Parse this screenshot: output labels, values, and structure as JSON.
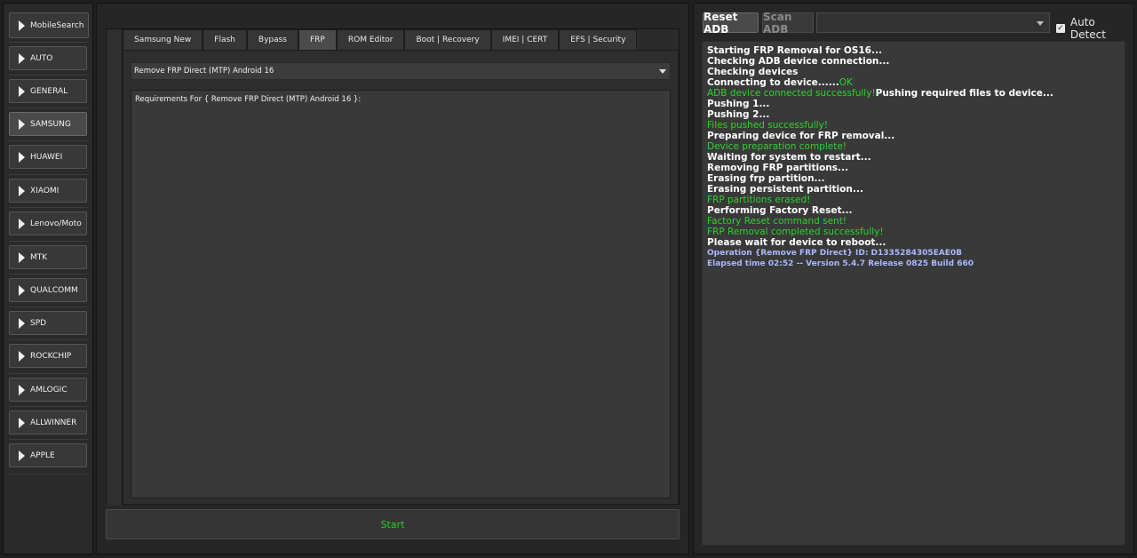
{
  "sidebar": {
    "items": [
      {
        "label": "MobileSearch"
      },
      {
        "label": "AUTO"
      },
      {
        "label": "GENERAL"
      },
      {
        "label": "SAMSUNG"
      },
      {
        "label": "HUAWEI"
      },
      {
        "label": "XIAOMI"
      },
      {
        "label": "Lenovo/Moto"
      },
      {
        "label": "MTK"
      },
      {
        "label": "QUALCOMM"
      },
      {
        "label": "SPD"
      },
      {
        "label": "ROCKCHIP"
      },
      {
        "label": "AMLOGIC"
      },
      {
        "label": "ALLWINNER"
      },
      {
        "label": "APPLE"
      }
    ],
    "active": "SAMSUNG"
  },
  "tabs": [
    {
      "label": "Samsung New"
    },
    {
      "label": "Flash"
    },
    {
      "label": "Bypass"
    },
    {
      "label": "FRP"
    },
    {
      "label": "ROM Editor"
    },
    {
      "label": "Boot | Recovery"
    },
    {
      "label": "IMEI | CERT"
    },
    {
      "label": "EFS | Security"
    }
  ],
  "active_tab": "FRP",
  "operation_select": {
    "value": "Remove FRP Direct (MTP) Android 16"
  },
  "requirements": {
    "text": "Requirements For { Remove FRP Direct (MTP) Android 16 }:"
  },
  "start_button": {
    "label": "Start"
  },
  "toolbar": {
    "reset_adb": "Reset ADB",
    "scan_adb": "Scan ADB",
    "port_select_value": "",
    "auto_detect_label": "Auto Detect",
    "auto_detect_checked": true
  },
  "log": [
    [
      {
        "t": "Starting FRP Removal for OS16...",
        "c": "w"
      }
    ],
    [
      {
        "t": "Checking ADB device connection...",
        "c": "w"
      }
    ],
    [
      {
        "t": "Checking devices",
        "c": "w"
      }
    ],
    [
      {
        "t": "Connecting to device......",
        "c": "w"
      },
      {
        "t": "OK",
        "c": "g"
      }
    ],
    [
      {
        "t": "ADB device connected successfully!",
        "c": "g"
      },
      {
        "t": "Pushing required files to device...",
        "c": "w"
      }
    ],
    [
      {
        "t": "Pushing 1...",
        "c": "w"
      }
    ],
    [
      {
        "t": "Pushing 2...",
        "c": "w"
      }
    ],
    [
      {
        "t": "Files pushed successfully!",
        "c": "g"
      }
    ],
    [
      {
        "t": "Preparing device for FRP removal...",
        "c": "w"
      }
    ],
    [
      {
        "t": "Device preparation complete!",
        "c": "g"
      }
    ],
    [
      {
        "t": "Waiting for system to restart...",
        "c": "w"
      }
    ],
    [
      {
        "t": "Removing FRP partitions...",
        "c": "w"
      }
    ],
    [
      {
        "t": "Erasing frp partition...",
        "c": "w"
      }
    ],
    [
      {
        "t": "Erasing persistent partition...",
        "c": "w"
      }
    ],
    [
      {
        "t": "FRP partitions erased!",
        "c": "g"
      }
    ],
    [
      {
        "t": "Performing Factory Reset...",
        "c": "w"
      }
    ],
    [
      {
        "t": "Factory Reset command sent!",
        "c": "g"
      }
    ],
    [
      {
        "t": "FRP Removal completed successfully!",
        "c": "g"
      }
    ],
    [
      {
        "t": "Please wait for device to reboot...",
        "c": "w"
      }
    ],
    [
      {
        "t": "Operation {Remove FRP Direct} ID: D1335284305EAE0B",
        "c": "b"
      }
    ],
    [
      {
        "t": "Elapsed time 02:52 -- Version 5.4.7 Release 0825 Build 660",
        "c": "b"
      }
    ]
  ],
  "colors": {
    "success": "#2fd12f",
    "info": "#aab8ff",
    "background": "#1f1f1f"
  }
}
